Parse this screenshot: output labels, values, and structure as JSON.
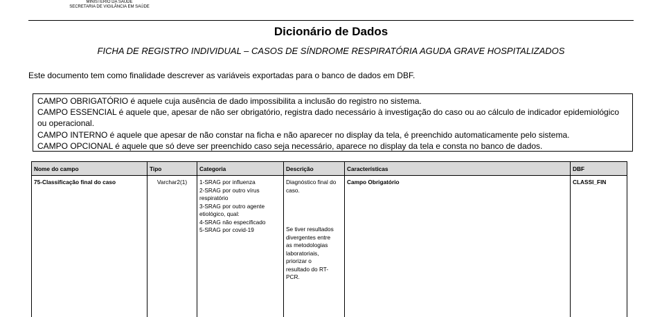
{
  "header": {
    "ministry_line1": "MINISTÉRIO DA SAÚDE",
    "ministry_line2": "SECRETARIA DE VIGILÂNCIA EM SAÚDE"
  },
  "document": {
    "title": "Dicionário de Dados",
    "subtitle": "FICHA DE REGISTRO INDIVIDUAL – CASOS DE SÍNDROME RESPIRATÓRIA AGUDA GRAVE HOSPITALIZADOS",
    "intro": "Este documento tem como finalidade descrever as variáveis exportadas para o banco de dados em DBF."
  },
  "definitions": [
    "CAMPO OBRIGATÓRIO é aquele cuja ausência de dado impossibilita a inclusão do registro no sistema.",
    "CAMPO ESSENCIAL é aquele que, apesar de não ser obrigatório, registra dado necessário à investigação do caso ou ao cálculo de indicador epidemiológico",
    "ou operacional.",
    "CAMPO INTERNO é aquele que apesar de não constar na ficha e não aparecer no display da tela, é preenchido automaticamente pelo sistema.",
    "CAMPO OPCIONAL é aquele que só deve ser preenchido caso seja necessário, aparece no display da tela e consta no banco de dados."
  ],
  "table": {
    "headers": [
      "Nome do campo",
      "Tipo",
      "Categoria",
      "Descrição",
      "Características",
      "DBF"
    ],
    "rows": [
      {
        "name": "75-Classificação final do caso",
        "type": "Varchar2(1)",
        "categories": [
          "1-SRAG por influenza",
          "2-SRAG por outro vírus",
          "respiratório",
          "3-SRAG por outro agente",
          "etiológico, qual:",
          "4-SRAG não especificado",
          "5-SRAG por covid-19"
        ],
        "description_a": [
          "Diagnóstico final do",
          "caso."
        ],
        "description_b": [
          "Se tiver resultados",
          "divergentes entre",
          "as metodologias",
          "laboratoriais,",
          "priorizar o",
          "resultado do RT-",
          "PCR."
        ],
        "characteristics": "Campo Obrigatório",
        "dbf": "CLASSI_FIN"
      }
    ]
  }
}
